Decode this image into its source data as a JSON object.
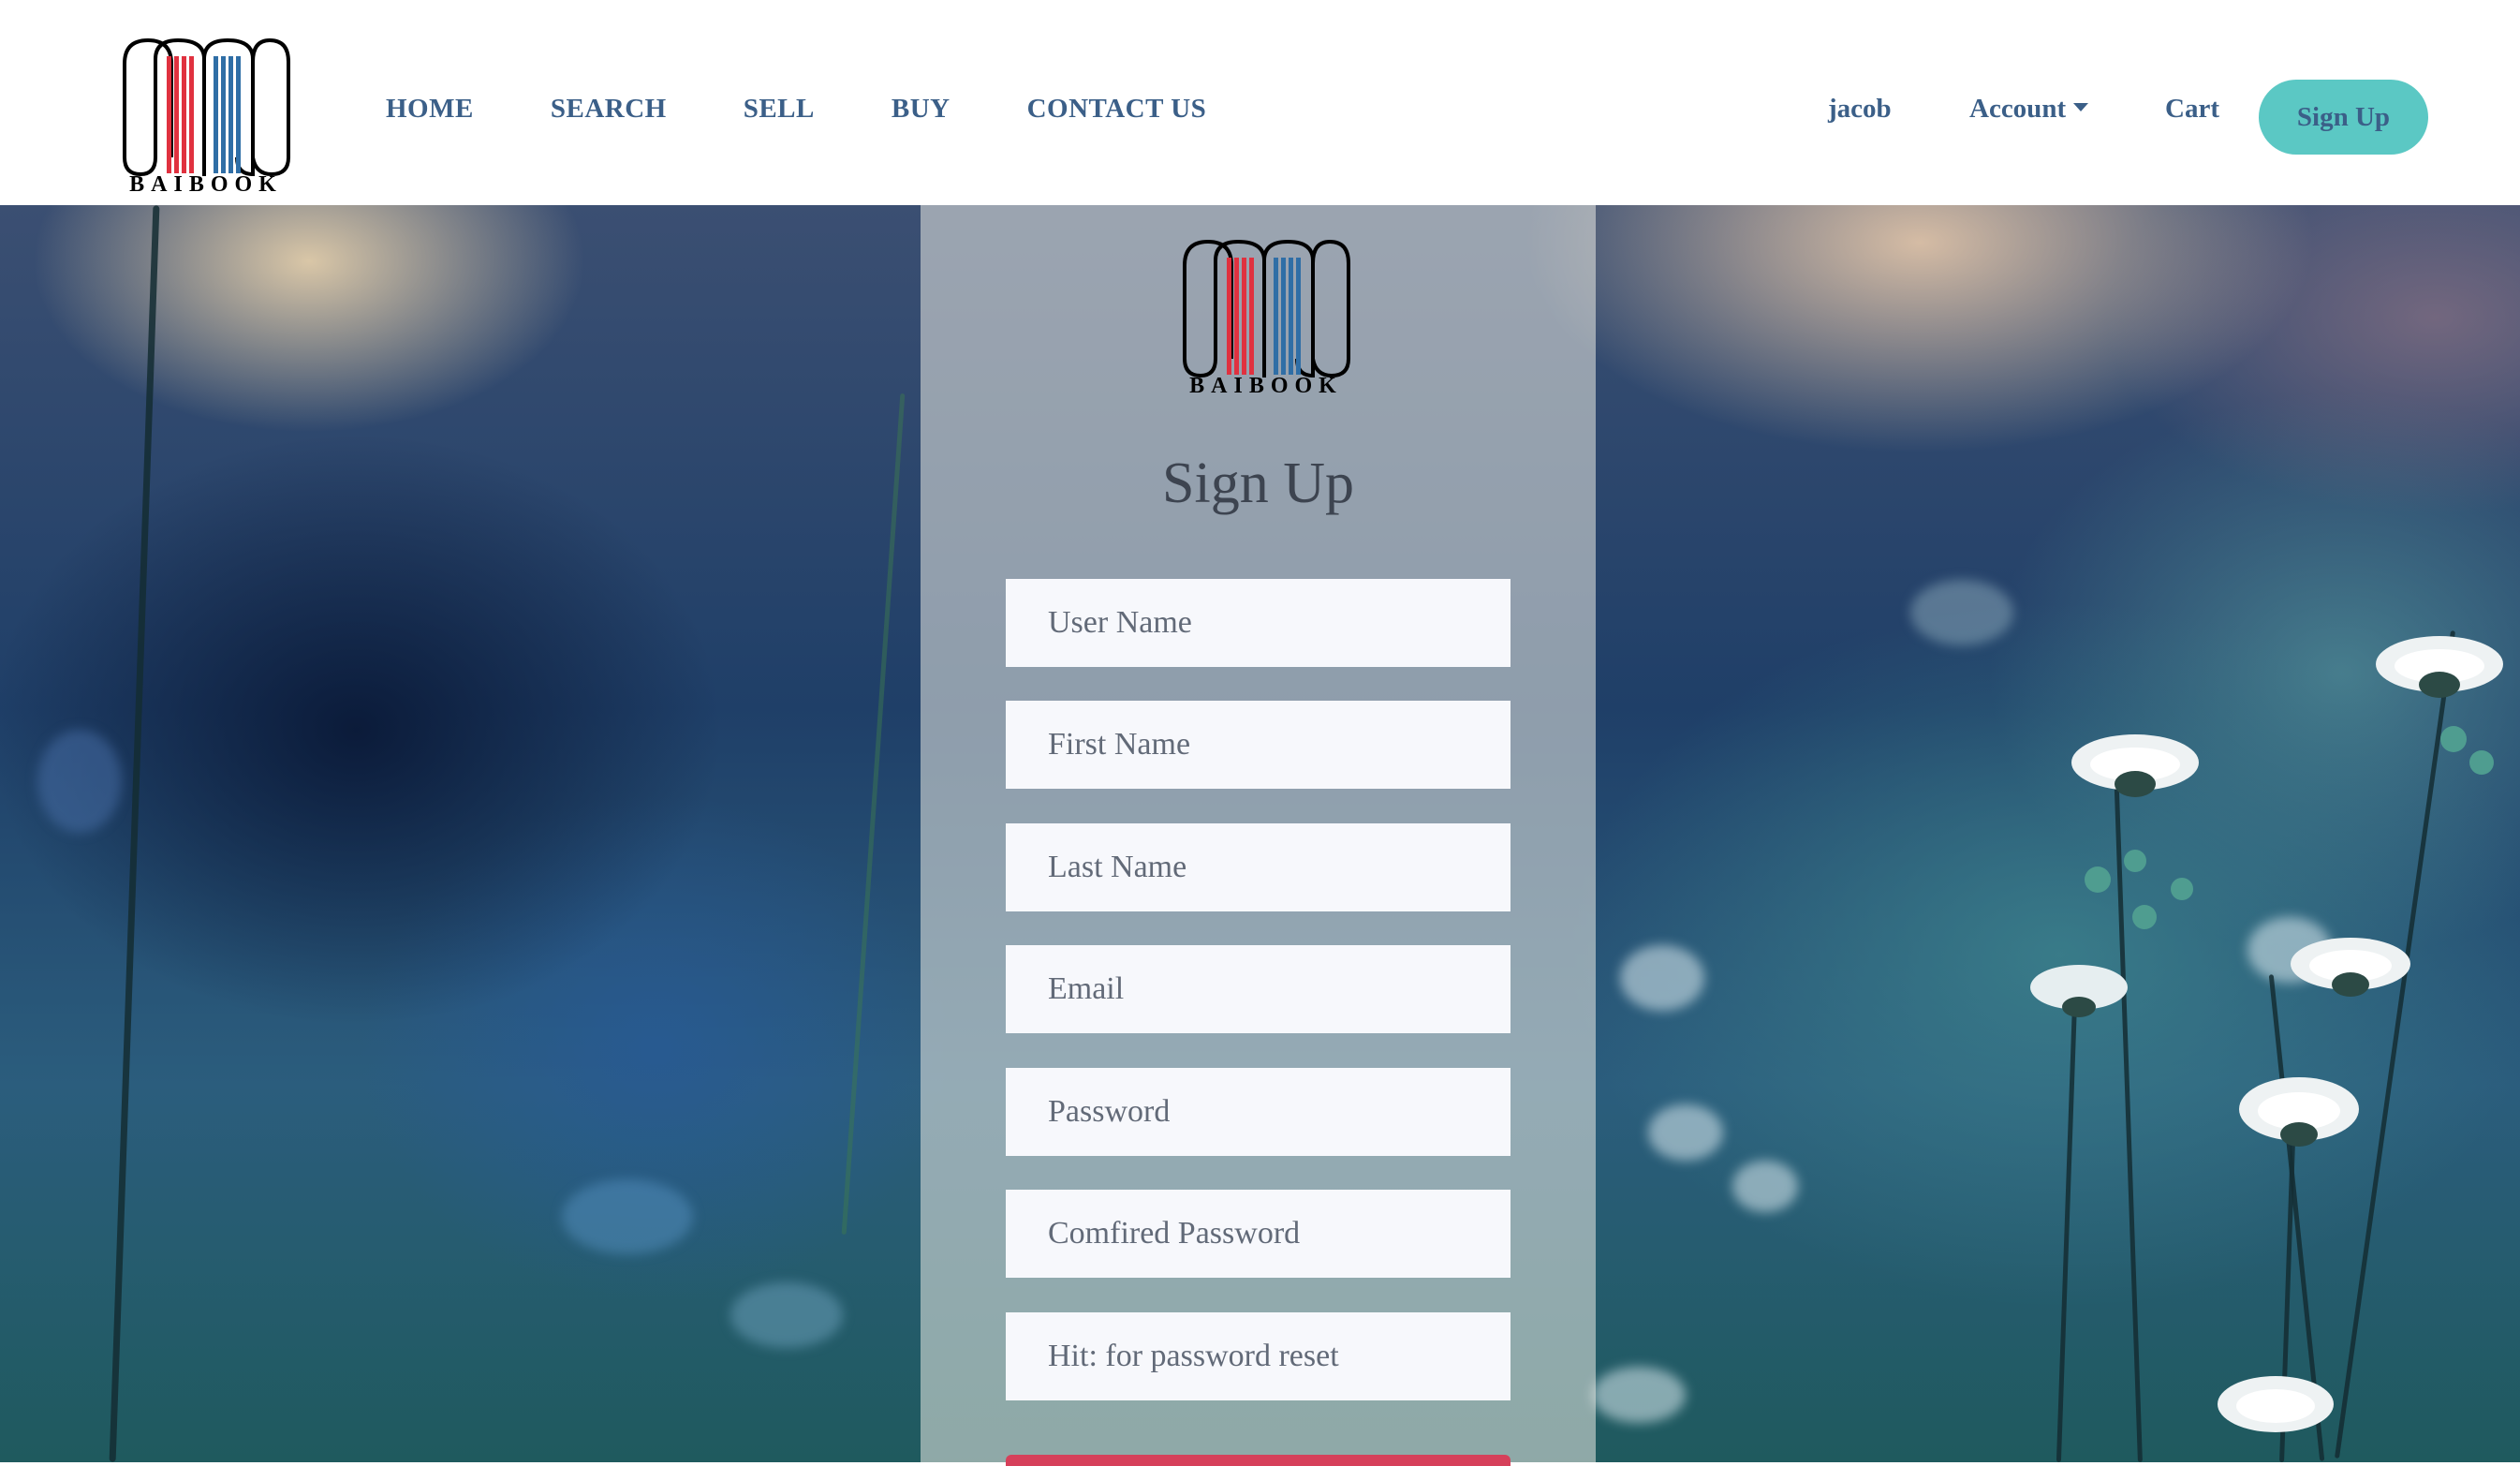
{
  "brand": {
    "name": "BAIBOOK",
    "colors": {
      "red": "#e0313f",
      "blue": "#2f6ea6",
      "accent": "#5bc8c4",
      "nav_text": "#3b5f88"
    }
  },
  "nav": {
    "links": [
      "HOME",
      "SEARCH",
      "SELL",
      "BUY",
      "CONTACT US"
    ],
    "user": "jacob",
    "account": "Account",
    "cart": "Cart",
    "signup": "Sign Up"
  },
  "form": {
    "title": "Sign Up",
    "fields": [
      {
        "placeholder": "User Name"
      },
      {
        "placeholder": "First Name"
      },
      {
        "placeholder": "Last Name"
      },
      {
        "placeholder": "Email"
      },
      {
        "placeholder": "Password"
      },
      {
        "placeholder": "Comfired Password"
      },
      {
        "placeholder": "Hit: for password reset"
      }
    ]
  },
  "icons": [
    "baibook-logo-icon",
    "caret-down-icon"
  ]
}
